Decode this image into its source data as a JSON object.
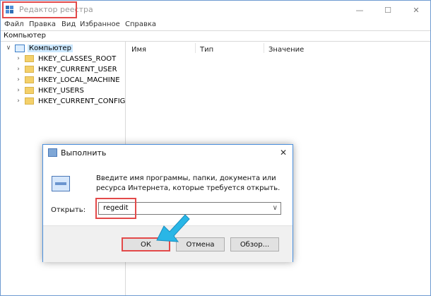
{
  "window": {
    "title": "Редактор реестра"
  },
  "menu": [
    "Файл",
    "Правка",
    "Вид",
    "Избранное",
    "Справка"
  ],
  "address": "Компьютер",
  "tree": {
    "root_label": "Компьютер",
    "items": [
      "HKEY_CLASSES_ROOT",
      "HKEY_CURRENT_USER",
      "HKEY_LOCAL_MACHINE",
      "HKEY_USERS",
      "HKEY_CURRENT_CONFIG"
    ]
  },
  "columns": {
    "name": "Имя",
    "type": "Тип",
    "value": "Значение"
  },
  "dialog": {
    "title": "Выполнить",
    "description": "Введите имя программы, папки, документа или ресурса Интернета, которые требуется открыть.",
    "open_label": "Открыть:",
    "input_value": "regedit",
    "ok_label": "ОК",
    "cancel_label": "Отмена",
    "browse_label": "Обзор..."
  },
  "colors": {
    "highlight": "#e34a4a",
    "selection": "#cce8ff",
    "accent": "#4a8fdd"
  }
}
